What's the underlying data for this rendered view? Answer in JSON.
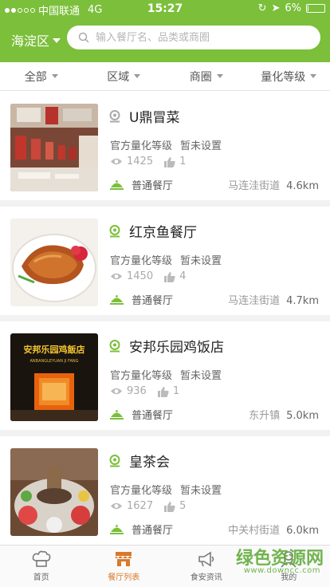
{
  "status_bar": {
    "carrier": "中国联通",
    "network": "4G",
    "time": "15:27",
    "battery": "6%",
    "battery_level": 0.06
  },
  "header": {
    "district": "海淀区",
    "search_placeholder": "输入餐厅名、品类或商圈"
  },
  "filters": [
    {
      "label": "全部"
    },
    {
      "label": "区域"
    },
    {
      "label": "商圈"
    },
    {
      "label": "量化等级"
    }
  ],
  "restaurants": [
    {
      "name": "U鼎冒菜",
      "grade_label": "官方量化等级",
      "grade_value": "暂未设置",
      "views": "1425",
      "likes": "1",
      "type": "普通餐厅",
      "street": "马连洼街道",
      "distance": "4.6km",
      "icon_color": "#aaaaaa"
    },
    {
      "name": "红京鱼餐厅",
      "grade_label": "官方量化等级",
      "grade_value": "暂未设置",
      "views": "1450",
      "likes": "4",
      "type": "普通餐厅",
      "street": "马连洼街道",
      "distance": "4.7km",
      "icon_color": "#7bbf3a"
    },
    {
      "name": "安邦乐园鸡饭店",
      "grade_label": "官方量化等级",
      "grade_value": "暂未设置",
      "views": "936",
      "likes": "1",
      "type": "普通餐厅",
      "street": "东升镇",
      "distance": "5.0km",
      "icon_color": "#7bbf3a"
    },
    {
      "name": "皇茶会",
      "grade_label": "官方量化等级",
      "grade_value": "暂未设置",
      "views": "1627",
      "likes": "5",
      "type": "普通餐厅",
      "street": "中关村街道",
      "distance": "6.0km",
      "icon_color": "#7bbf3a"
    }
  ],
  "tabs": [
    {
      "label": "首页",
      "icon": "chef-hat-icon"
    },
    {
      "label": "餐厅列表",
      "icon": "restaurant-list-icon",
      "active": true
    },
    {
      "label": "食安资讯",
      "icon": "megaphone-icon"
    },
    {
      "label": "我的",
      "icon": "profile-icon"
    }
  ],
  "shop_sign": {
    "title": "安邦乐园鸡飯店",
    "subtitle": "ANBANGLEYUAN JI FANG"
  },
  "watermark": {
    "title": "绿色资源网",
    "url": "www.downcc.com"
  },
  "colors": {
    "brand_green": "#7bbf3a",
    "active_tab": "#d87a2a"
  }
}
